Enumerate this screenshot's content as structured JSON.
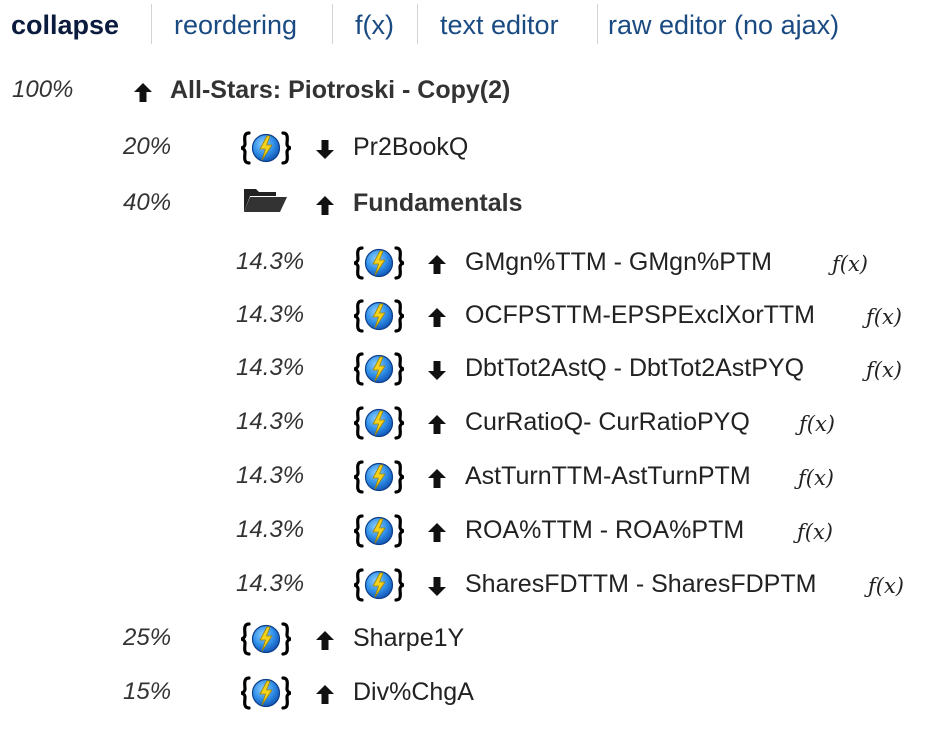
{
  "toolbar": {
    "collapse": "collapse",
    "reordering": "reordering",
    "fx": "f(x)",
    "text_editor": "text editor",
    "raw_editor": "raw editor (no ajax)"
  },
  "root": {
    "weight": "100%",
    "direction": "up",
    "label": "All-Stars: Piotroski - Copy(2)"
  },
  "nodes": [
    {
      "weight": "20%",
      "kind": "formula",
      "direction": "down",
      "label": "Pr2BookQ"
    },
    {
      "weight": "40%",
      "kind": "folder",
      "direction": "up",
      "label": "Fundamentals"
    },
    {
      "weight": "14.3%",
      "kind": "formula",
      "direction": "up",
      "label": "GMgn%TTM - GMgn%PTM",
      "fx": "ƒ(x)"
    },
    {
      "weight": "14.3%",
      "kind": "formula",
      "direction": "up",
      "label": "OCFPSTTM-EPSPExclXorTTM",
      "fx": "ƒ(x)"
    },
    {
      "weight": "14.3%",
      "kind": "formula",
      "direction": "down",
      "label": "DbtTot2AstQ - DbtTot2AstPYQ",
      "fx": "ƒ(x)"
    },
    {
      "weight": "14.3%",
      "kind": "formula",
      "direction": "up",
      "label": "CurRatioQ- CurRatioPYQ",
      "fx": "ƒ(x)"
    },
    {
      "weight": "14.3%",
      "kind": "formula",
      "direction": "up",
      "label": "AstTurnTTM-AstTurnPTM",
      "fx": "ƒ(x)"
    },
    {
      "weight": "14.3%",
      "kind": "formula",
      "direction": "up",
      "label": "ROA%TTM - ROA%PTM",
      "fx": "ƒ(x)"
    },
    {
      "weight": "14.3%",
      "kind": "formula",
      "direction": "down",
      "label": "SharesFDTTM - SharesFDPTM",
      "fx": "ƒ(x)"
    },
    {
      "weight": "25%",
      "kind": "formula",
      "direction": "up",
      "label": "Sharpe1Y"
    },
    {
      "weight": "15%",
      "kind": "formula",
      "direction": "up",
      "label": "Div%ChgA"
    }
  ],
  "colors": {
    "link": "#1a4a82",
    "active": "#0b1b3e",
    "globe": "#2f8fe8",
    "bolt": "#f2d21c"
  }
}
